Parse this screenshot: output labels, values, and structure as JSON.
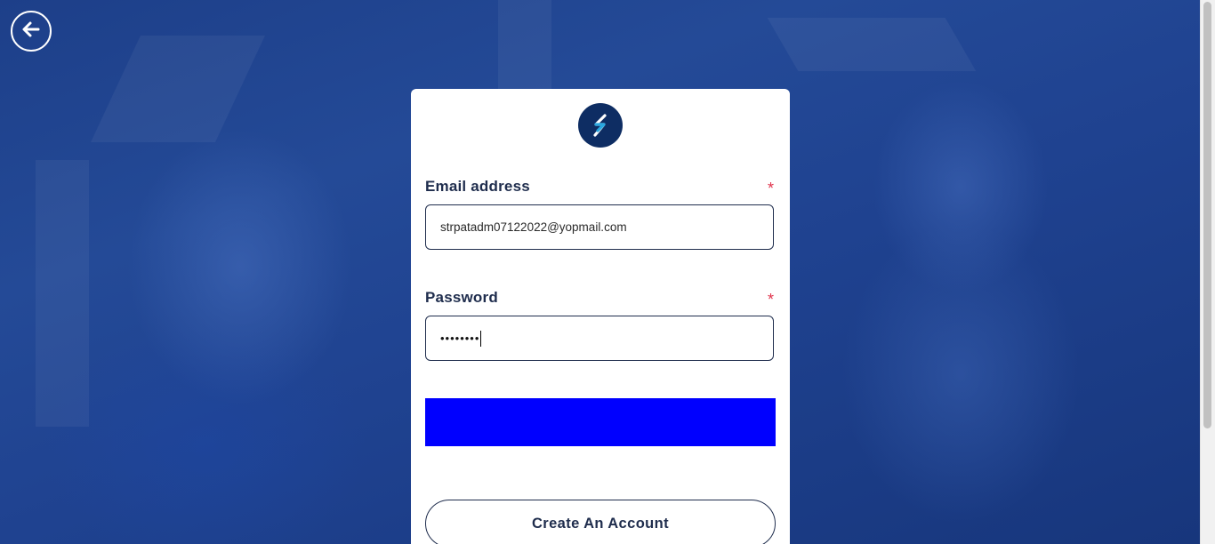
{
  "header": {
    "back_icon": "arrow-left-circle-icon"
  },
  "card": {
    "logo_icon": "brand-s-logo-icon",
    "email": {
      "label": "Email address",
      "required_mark": "*",
      "value": "strpatadm07122022@yopmail.com"
    },
    "password": {
      "label": "Password",
      "required_mark": "*",
      "masked_value": "••••••••"
    },
    "primary_button_label": "",
    "create_account_label": "Create An Account"
  },
  "colors": {
    "background": "#1e3f8a",
    "card": "#ffffff",
    "text": "#1f2d4d",
    "required": "#e0344c",
    "primary_button": "#0000ff",
    "logo_bg": "#0e2d63",
    "logo_accent": "#29a8e0"
  }
}
